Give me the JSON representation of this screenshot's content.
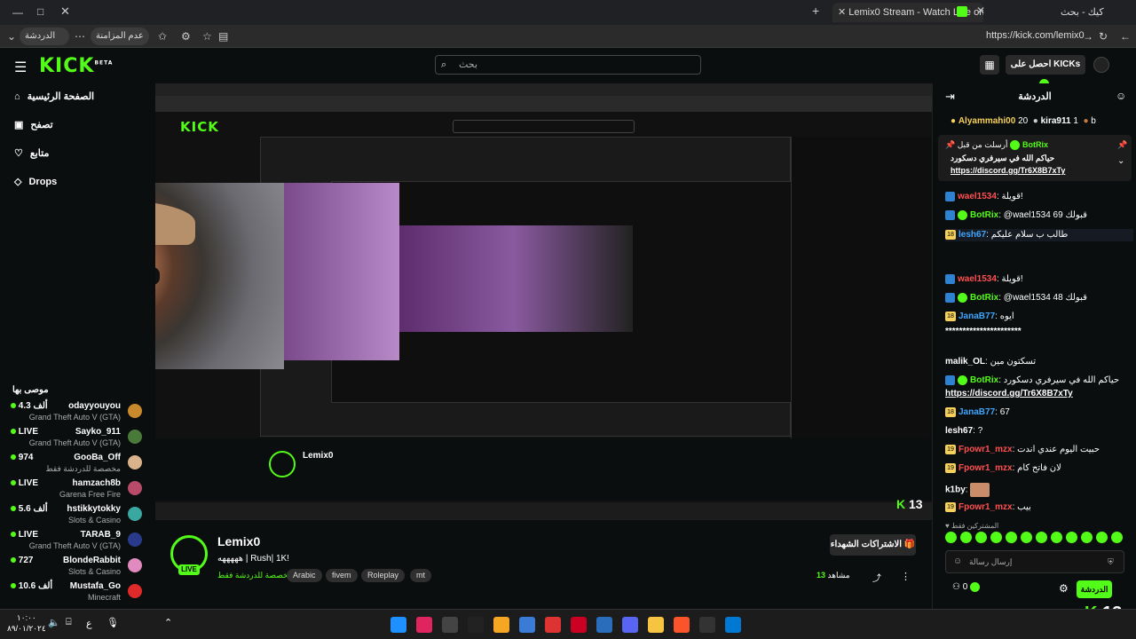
{
  "browser": {
    "tabs": [
      {
        "label": "كيك - بحث",
        "active": false
      },
      {
        "label": "Lemix0 Stream - Watch Live on Kick",
        "active": true
      }
    ],
    "url": "https://kick.com/lemix0",
    "profile_label": "عدم المزامنة",
    "chat_label": "الدردشة"
  },
  "header": {
    "logo": "KICK",
    "logo_sup": "BETA",
    "search_placeholder": "بحث",
    "get_kicks_label": "احصل على KICKs"
  },
  "sidebar": {
    "nav": [
      {
        "label": "الصفحة الرئيسية",
        "icon": "home-icon"
      },
      {
        "label": "تصفح",
        "icon": "browse-icon"
      },
      {
        "label": "متابع",
        "icon": "heart-icon"
      },
      {
        "label": "Drops",
        "icon": "drops-icon"
      }
    ],
    "recommended_title": "موصى بها",
    "recommended": [
      {
        "name": "odayyouyou",
        "category": "Grand Theft Auto V (GTA)",
        "viewers": "4.3 ألف",
        "color": "#c98a2b"
      },
      {
        "name": "Sayko_911",
        "category": "Grand Theft Auto V (GTA)",
        "viewers": "LIVE",
        "color": "#4a7a3a"
      },
      {
        "name": "GooBa_Off",
        "category": "مخصصة للدردشة فقط",
        "viewers": "974",
        "color": "#d9b38c"
      },
      {
        "name": "hamzach8b",
        "category": "Garena Free Fire",
        "viewers": "LIVE",
        "color": "#b84a6a"
      },
      {
        "name": "hstikkytokky",
        "category": "Slots & Casino",
        "viewers": "5.6 ألف",
        "color": "#3aa8a0"
      },
      {
        "name": "TARAB_9",
        "category": "Grand Theft Auto V (GTA)",
        "viewers": "LIVE",
        "color": "#2a3a8a"
      },
      {
        "name": "BlondeRabbit",
        "category": "Slots & Casino",
        "viewers": "727",
        "color": "#e08ac0"
      },
      {
        "name": "Mustafa_Go",
        "category": "Minecraft",
        "viewers": "10.6 ألف",
        "color": "#e02a2a"
      }
    ]
  },
  "stream": {
    "streamer": "Lemix0",
    "title": "هههههه | Rush| 1K!",
    "category": "مخصصة للدردشة فقط",
    "tags": [
      "Arabic",
      "fivem",
      "Roleplay",
      "mt"
    ],
    "live_label": "LIVE",
    "subscribe_label": "الاشتراكات الشهداء",
    "viewers": "13",
    "viewers_label": "مشاهد"
  },
  "chat": {
    "title": "الدردشة",
    "top_gifters": [
      {
        "name": "Alyammahi00",
        "count": "20"
      },
      {
        "name": "kira911",
        "count": "1"
      },
      {
        "name": "b",
        "count": ""
      }
    ],
    "pinned": {
      "label": "أرسلت من قبل",
      "user": "BotRix",
      "text": "حياكم الله في سيرفري دسكورد",
      "link": "https://discord.gg/Tr6X8B7xTy"
    },
    "messages": [
      {
        "user": "wael1534",
        "color": "red-blue",
        "text": "قويلة!"
      },
      {
        "user": "BotRix",
        "color": "green",
        "text": "@wael1534 69 قبولك"
      },
      {
        "user": "lesh67",
        "color": "blue",
        "text": "طالب ب سلام عليكم"
      },
      {
        "user": "wael1534",
        "color": "red-blue",
        "text": "قويلة!"
      },
      {
        "user": "BotRix",
        "color": "green",
        "text": "@wael1534 48 قبولك"
      },
      {
        "user": "JanaB77",
        "color": "blue",
        "text": "ايوه"
      },
      {
        "user": "",
        "color": "white",
        "text": "**********************"
      },
      {
        "user": "malik_OL",
        "color": "white",
        "text": "تسكتون مين"
      },
      {
        "user": "BotRix",
        "color": "green",
        "text": "حياكم الله في سيرفري دسكورد"
      },
      {
        "user": "",
        "color": "link",
        "text": "https://discord.gg/Tr6X8B7xTy"
      },
      {
        "user": "JanaB77",
        "color": "blue",
        "text": "67"
      },
      {
        "user": "lesh67",
        "color": "white",
        "text": "?"
      },
      {
        "user": "Fpowr1_mzx",
        "color": "red",
        "text": "حبيت اليوم عندي اندت"
      },
      {
        "user": "Fpowr1_mzx",
        "color": "red",
        "text": "لان فاتح كام"
      },
      {
        "user": "k1by",
        "color": "white",
        "text": ""
      },
      {
        "user": "Fpowr1_mzx",
        "color": "red",
        "text": "بيب"
      }
    ],
    "subs_label": "المشتركين فقط",
    "input_placeholder": "إرسال رسالة",
    "send_label": "الدردشة",
    "kicks_count": "0"
  },
  "overlay": {
    "kick_count": "13"
  },
  "taskbar": {
    "time": "١٠:٠٠",
    "date": "٨٩/٠١/٢٠٢٤",
    "lang": "ع"
  },
  "colors": {
    "accent": "#53fc18",
    "bg": "#0b0e0f",
    "blue_name": "#3ea6ff",
    "red_name": "#ff5050"
  }
}
